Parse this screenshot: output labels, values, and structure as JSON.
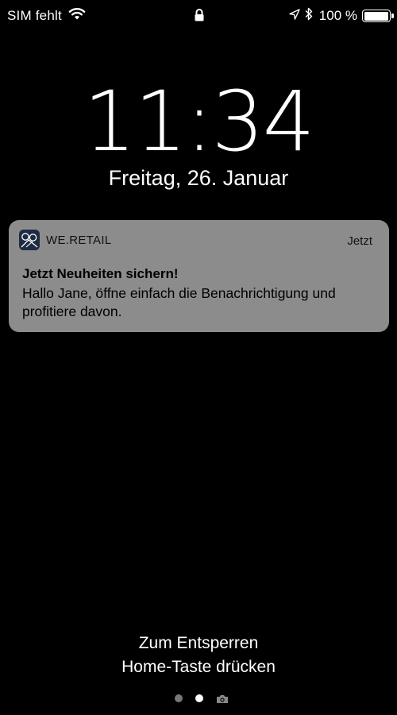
{
  "status_bar": {
    "carrier": "SIM fehlt",
    "battery_percent_label": "100 %",
    "battery_level": 1.0,
    "icons": [
      "wifi-icon",
      "lock-icon",
      "location-arrow-icon",
      "bluetooth-icon",
      "battery-icon"
    ]
  },
  "lockscreen": {
    "time": "11:34",
    "date": "Freitag, 26. Januar"
  },
  "notification": {
    "app_name": "WE.RETAIL",
    "time": "Jetzt",
    "title": "Jetzt Neuheiten sichern!",
    "body": "Hallo Jane, öffne einfach die Benachrichtigung und profitiere davon.",
    "app_icon": "we-retail-app-icon"
  },
  "unlock_hint": {
    "line1": "Zum Entsperren",
    "line2": "Home-Taste drücken"
  },
  "page_indicator": {
    "pages": 3,
    "active_index": 1,
    "last_icon": "camera-icon"
  },
  "colors": {
    "background": "#000000",
    "notification_bg": "#8c8c8c",
    "text": "#ffffff"
  }
}
